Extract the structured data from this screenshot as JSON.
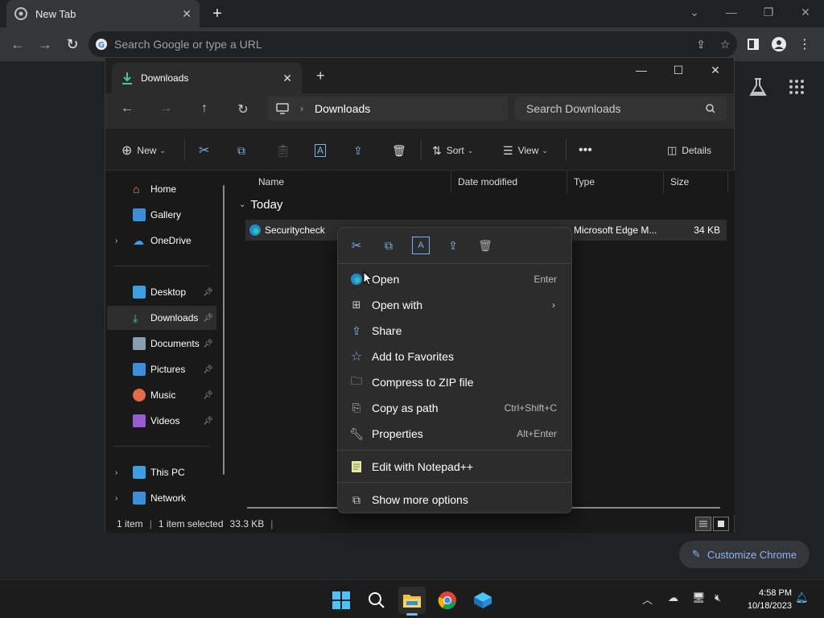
{
  "chrome": {
    "tab_title": "New Tab",
    "omnibox_placeholder": "Search Google or type a URL",
    "customize_label": "Customize Chrome"
  },
  "explorer": {
    "tab_title": "Downloads",
    "breadcrumb": [
      "Downloads"
    ],
    "search_placeholder": "Search Downloads",
    "commands": {
      "new": "New",
      "sort": "Sort",
      "view": "View",
      "details": "Details"
    },
    "nav": {
      "quick": [
        {
          "label": "Home",
          "icon": "home-icon"
        },
        {
          "label": "Gallery",
          "icon": "gallery-icon"
        },
        {
          "label": "OneDrive",
          "icon": "onedrive-icon"
        }
      ],
      "pinned": [
        {
          "label": "Desktop",
          "icon": "desktop-icon"
        },
        {
          "label": "Downloads",
          "icon": "download-icon"
        },
        {
          "label": "Documents",
          "icon": "documents-icon"
        },
        {
          "label": "Pictures",
          "icon": "pictures-icon"
        },
        {
          "label": "Music",
          "icon": "music-icon"
        },
        {
          "label": "Videos",
          "icon": "videos-icon"
        }
      ],
      "devices": [
        {
          "label": "This PC",
          "icon": "pc-icon"
        },
        {
          "label": "Network",
          "icon": "network-icon"
        }
      ]
    },
    "columns": [
      "Name",
      "Date modified",
      "Type",
      "Size"
    ],
    "group": "Today",
    "file": {
      "name": "Securitycheck",
      "type": "Microsoft Edge M...",
      "size": "34 KB"
    },
    "status": {
      "count": "1 item",
      "selected": "1 item selected",
      "size": "33.3 KB"
    }
  },
  "context_menu": {
    "items": [
      {
        "label": "Open",
        "shortcut": "Enter",
        "icon": "edge-icon"
      },
      {
        "label": "Open with",
        "shortcut": "",
        "icon": "open-with-icon",
        "submenu": true
      },
      {
        "label": "Share",
        "shortcut": "",
        "icon": "share-icon"
      },
      {
        "label": "Add to Favorites",
        "shortcut": "",
        "icon": "star-icon"
      },
      {
        "label": "Compress to ZIP file",
        "shortcut": "",
        "icon": "zip-icon"
      },
      {
        "label": "Copy as path",
        "shortcut": "Ctrl+Shift+C",
        "icon": "copy-path-icon"
      },
      {
        "label": "Properties",
        "shortcut": "Alt+Enter",
        "icon": "wrench-icon"
      }
    ],
    "extra_item": "Edit with Notepad++",
    "more_item": "Show more options"
  },
  "taskbar": {
    "time": "4:58 PM",
    "date": "10/18/2023"
  },
  "colors": {
    "accent": "#76b9ed",
    "menu_bg": "#2c2c2c",
    "explorer_bg": "#191919"
  }
}
